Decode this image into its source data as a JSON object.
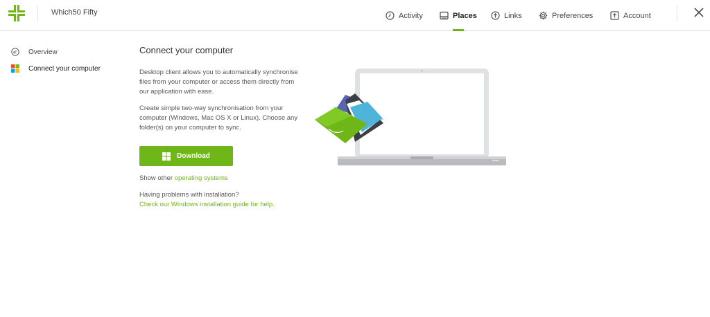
{
  "header": {
    "app_name": "Which50 Fifty",
    "nav": [
      {
        "label": "Activity",
        "icon": "clock-icon"
      },
      {
        "label": "Places",
        "icon": "drive-icon",
        "active": true
      },
      {
        "label": "Links",
        "icon": "cloud-upload-icon"
      },
      {
        "label": "Preferences",
        "icon": "gear-icon"
      },
      {
        "label": "Account",
        "icon": "account-icon"
      }
    ],
    "close_icon": "close-icon"
  },
  "sidebar": {
    "items": [
      {
        "label": "Overview",
        "icon": "overview-icon"
      },
      {
        "label": "Connect your computer",
        "icon": "windows-icon",
        "active": true
      }
    ]
  },
  "main": {
    "title": "Connect your computer",
    "paragraph1": "Desktop client allows you to automatically synchronise files from your computer or access them directly from our application with ease.",
    "paragraph2": "Create simple two-way synchronisation from your computer (Windows, Mac OS X or Linux). Choose any folder(s) on your computer to sync.",
    "download_label": "Download",
    "other_os_prefix": "Show other ",
    "other_os_link": "operating systems",
    "problems_text": "Having problems with installation?",
    "guide_link": "Check our Windows installation guide for help."
  },
  "colors": {
    "accent": "#6fb718",
    "windows_red": "#f25022",
    "windows_green": "#7fba00",
    "windows_blue": "#00a4ef",
    "windows_yellow": "#ffb900"
  }
}
